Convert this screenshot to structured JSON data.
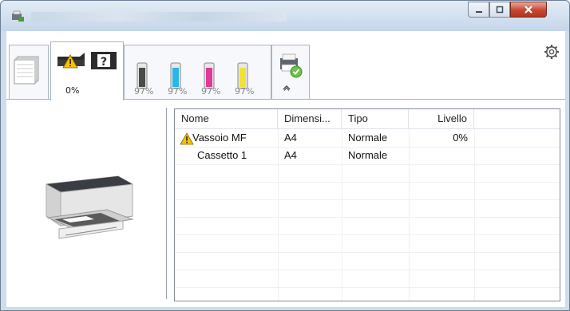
{
  "window": {
    "status_tab": {
      "percent": "0%"
    },
    "toner": [
      {
        "label": "97%",
        "color": "#4a4a4a"
      },
      {
        "label": "97%",
        "color": "#29b6e8"
      },
      {
        "label": "97%",
        "color": "#e0399a"
      },
      {
        "label": "97%",
        "color": "#f2e238"
      }
    ]
  },
  "table": {
    "headers": [
      "Nome",
      "Dimensi...",
      "Tipo",
      "Livello"
    ],
    "rows": [
      {
        "nome": "Vassoio MF",
        "dim": "A4",
        "tipo": "Normale",
        "livello": "0%"
      },
      {
        "nome": "Cassetto 1",
        "dim": "A4",
        "tipo": "Normale",
        "livello": ""
      }
    ]
  }
}
